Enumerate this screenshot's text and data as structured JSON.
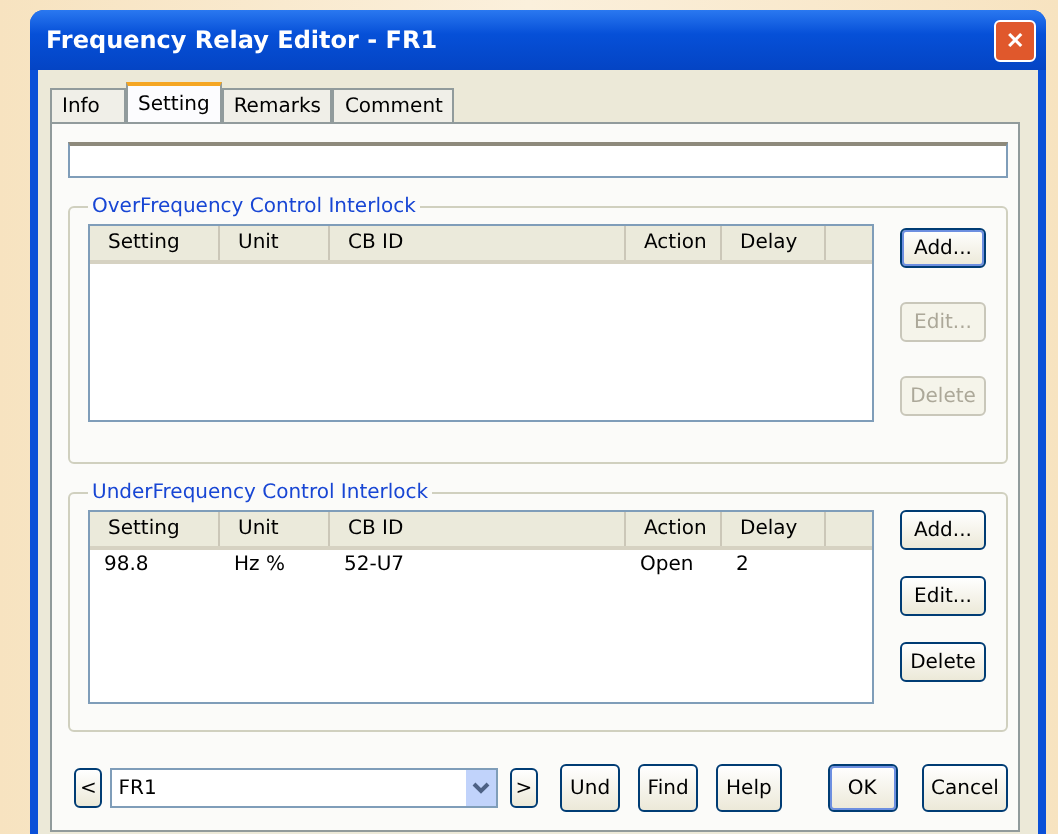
{
  "window": {
    "title": "Frequency Relay Editor - FR1",
    "close": "✕"
  },
  "tabs": [
    {
      "label": "Info",
      "selected": false
    },
    {
      "label": "Setting",
      "selected": true
    },
    {
      "label": "Remarks",
      "selected": false
    },
    {
      "label": "Comment",
      "selected": false
    }
  ],
  "groups": [
    {
      "title": "OverFrequency Control Interlock",
      "columns": [
        "Setting",
        "Unit",
        "CB ID",
        "Action",
        "Delay"
      ],
      "buttons": [
        {
          "label": "Add...",
          "disabled": false
        },
        {
          "label": "Edit...",
          "disabled": true
        },
        {
          "label": "Delete",
          "disabled": true
        }
      ]
    },
    {
      "title": "UnderFrequency Control Interlock",
      "columns": [
        "Setting",
        "Unit",
        "CB ID",
        "Action",
        "Delay"
      ],
      "rows": [
        [
          "98.8",
          "Hz %",
          "52-U7",
          "Open",
          "2"
        ]
      ],
      "buttons": [
        {
          "label": "Add...",
          "disabled": false
        },
        {
          "label": "Edit...",
          "disabled": false
        },
        {
          "label": "Delete",
          "disabled": false
        }
      ]
    }
  ],
  "footer": {
    "prev": "<",
    "combo": "FR1",
    "next": ">",
    "buttons": [
      "Und",
      "Find",
      "Help"
    ],
    "ok": "OK",
    "cancel": "Cancel"
  }
}
